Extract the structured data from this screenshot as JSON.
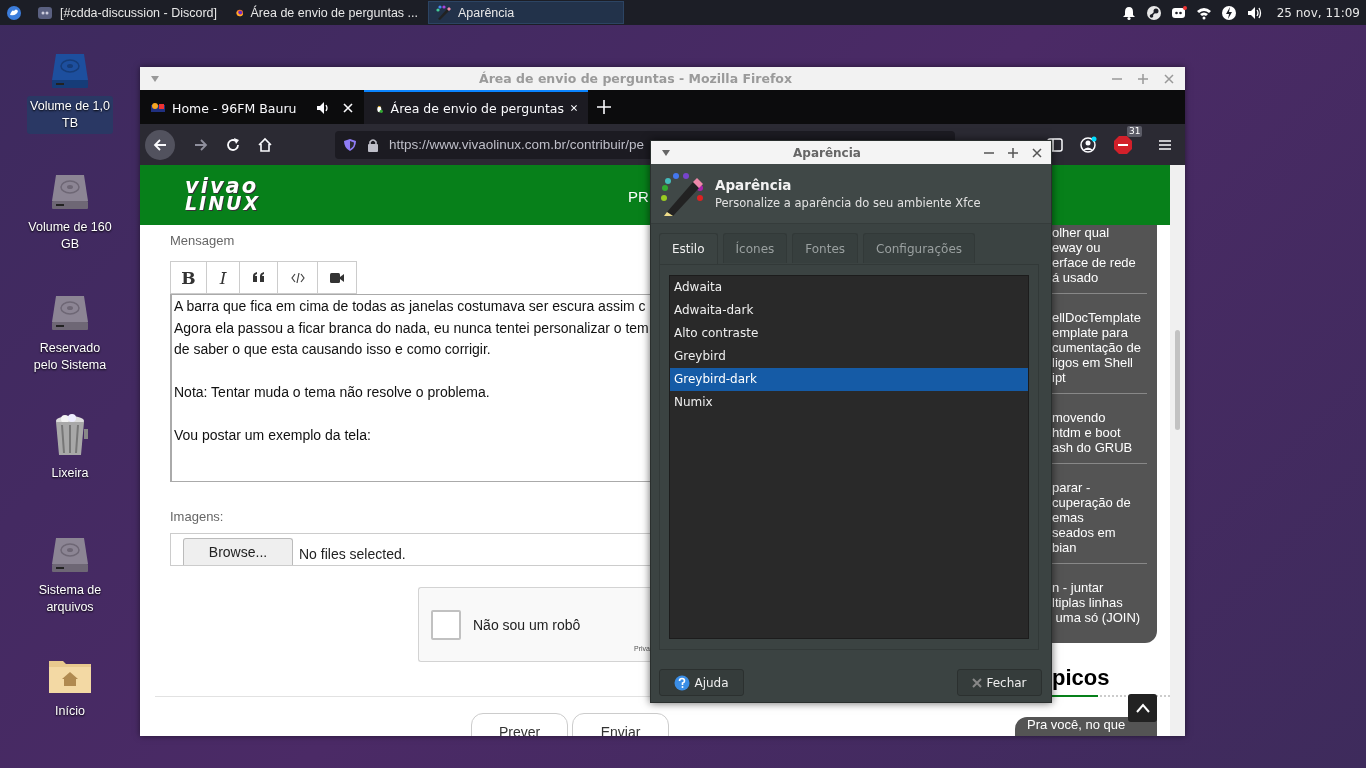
{
  "panel": {
    "tasks": [
      {
        "label": "[#cdda-discussion - Discord]",
        "kind": "chat",
        "selected": false
      },
      {
        "label": "Área de envio de perguntas ...",
        "kind": "browser",
        "selected": false
      },
      {
        "label": "Aparência",
        "kind": "appearance",
        "selected": true
      }
    ],
    "clock": "25 nov, 11:09"
  },
  "desktop_icons": [
    {
      "label": "Volume de 1,0 TB",
      "kind": "drive",
      "selected": true
    },
    {
      "label": "Volume de 160 GB",
      "kind": "drive",
      "selected": false
    },
    {
      "label": "Reservado pelo Sistema",
      "kind": "drive",
      "selected": false
    },
    {
      "label": "Lixeira",
      "kind": "trash",
      "selected": false
    },
    {
      "label": "Sistema de arquivos",
      "kind": "drive",
      "selected": false
    },
    {
      "label": "Início",
      "kind": "home",
      "selected": false
    }
  ],
  "browser": {
    "title": "Área de envio de perguntas - Mozilla Firefox",
    "tabs": [
      {
        "label": "Home - 96FM Bauru",
        "kind": "radio",
        "audio": true,
        "selected": false
      },
      {
        "label": "Área de envio de perguntas",
        "kind": "penguin",
        "audio": false,
        "selected": true
      }
    ],
    "url": "https://www.vivaolinux.com.br/contribuir/pe",
    "adblock_count": "31",
    "page": {
      "logo": [
        "vivao",
        "LINUX"
      ],
      "nav_item": "PR",
      "message_label": "Mensagem",
      "editor_tools": [
        {
          "kind": "bold",
          "label": "B"
        },
        {
          "kind": "italic",
          "label": "I"
        },
        {
          "kind": "quote"
        },
        {
          "kind": "code"
        },
        {
          "kind": "video"
        }
      ],
      "message_paragraphs": [
        [
          "A barra que fica em cima de todas as janelas costumava ser escura assim c",
          "Agora ela passou a ficar branca do nada, eu nunca tentei personalizar o tem",
          "de saber o que esta causando isso e como corrigir."
        ],
        [
          "Nota: Tentar muda o tema não resolve o problema."
        ],
        [
          "Vou postar um exemplo da tela:"
        ]
      ],
      "images_label": "Imagens:",
      "file_input": {
        "button": "Browse...",
        "status": "No files selected."
      },
      "captcha": {
        "label": "Não sou um robô",
        "checked": false,
        "privacy": "Priva"
      },
      "form_buttons": [
        "Prever",
        "Enviar"
      ],
      "sidebar": {
        "articles": [
          {
            "lines": [
              "olher qual",
              "eway ou",
              "erface de rede",
              "á usado"
            ]
          },
          {
            "lines": [
              "ellDocTemplate",
              "emplate para",
              "cumentação de",
              "ligos em Shell",
              "ipt"
            ]
          },
          {
            "lines": [
              "movendo",
              "htdm e boot",
              "ash do GRUB"
            ]
          },
          {
            "lines": [
              "parar -",
              "cuperação de",
              "emas",
              "seados em",
              "bian"
            ]
          },
          {
            "lines": [
              "n - juntar",
              "ltiplas linhas",
              " uma só (JOIN)"
            ]
          }
        ],
        "heading": "picos",
        "teaser": "Pra você, no que"
      }
    }
  },
  "dialog": {
    "title": "Aparência",
    "header_title": "Aparência",
    "header_subtitle": "Personalize a aparência do seu ambiente Xfce",
    "tabs": [
      {
        "label": "Estilo",
        "selected": true
      },
      {
        "label": "Ícones",
        "selected": false
      },
      {
        "label": "Fontes",
        "selected": false
      },
      {
        "label": "Configurações",
        "selected": false
      }
    ],
    "themes": [
      {
        "label": "Adwaita",
        "selected": false
      },
      {
        "label": "Adwaita-dark",
        "selected": false
      },
      {
        "label": "Alto contraste",
        "selected": false
      },
      {
        "label": "Greybird",
        "selected": false
      },
      {
        "label": "Greybird-dark",
        "selected": true
      },
      {
        "label": "Numix",
        "selected": false
      }
    ],
    "buttons": [
      {
        "label": "Ajuda",
        "kind": "help"
      },
      {
        "label": "Fechar",
        "kind": "close"
      }
    ]
  }
}
